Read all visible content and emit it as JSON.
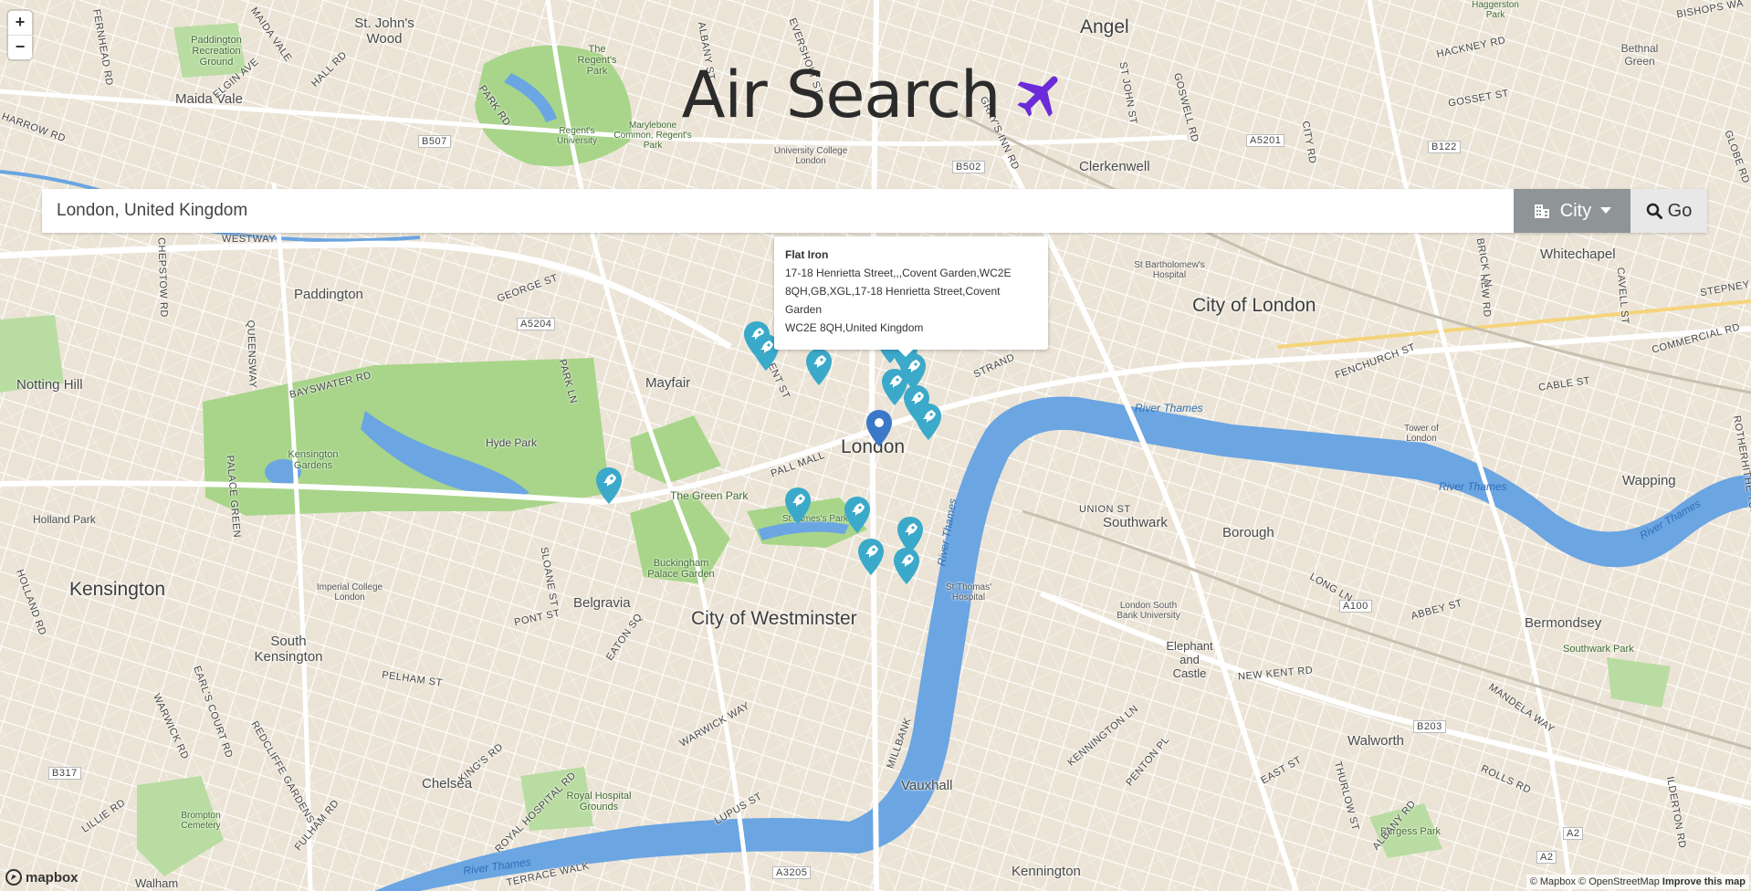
{
  "app": {
    "title": "Air Search",
    "title_icon": "airplane-icon",
    "accent_color": "#6c2bd9"
  },
  "map_controls": {
    "zoom_in": "+",
    "zoom_out": "−"
  },
  "search": {
    "value": "London, United Kingdom",
    "mode_label": "City",
    "mode_icon": "building-icon",
    "go_label": "Go",
    "go_icon": "search-icon"
  },
  "popup": {
    "title": "Flat Iron",
    "lines": [
      "17-18 Henrietta Street,,,Covent Garden,WC2E",
      "8QH,GB,XGL,17-18 Henrietta Street,Covent Garden",
      "WC2E 8QH,United Kingdom"
    ]
  },
  "map_labels": {
    "big": [
      "Angel",
      "City of London",
      "London",
      "City of Westminster",
      "Kensington"
    ],
    "mid": [
      "St. John's Wood",
      "Maida Vale",
      "Clerkenwell",
      "Paddington",
      "Notting Hill",
      "Mayfair",
      "Hyde Park",
      "Belgravia",
      "Southwark",
      "Borough",
      "Chelsea",
      "South Kensington",
      "Vauxhall",
      "Elephant and Castle",
      "Walworth",
      "Bermondsey",
      "Whitechapel",
      "Wapping",
      "Holland Park",
      "Kennington",
      "Walham"
    ],
    "parks": [
      "Paddington Recreation Ground",
      "The Regent's Park",
      "Regent's University",
      "Marylebone Common, Regent's Park",
      "Kensington Gardens",
      "The Green Park",
      "St James's Park",
      "Buckingham Palace Garden",
      "Imperial College London",
      "Royal Hospital Grounds",
      "Brompton Cemetery",
      "Burgess Park",
      "Southwark Park",
      "Tower of London",
      "University College London",
      "St Thomas' Hospital",
      "St Bartholomew's Hospital",
      "London South Bank University",
      "Haggerston Park",
      "Bethnal Green"
    ],
    "water": [
      "River Thames",
      "River Thames",
      "River Thames",
      "River Thames",
      "River Thames"
    ],
    "roads": [
      "B507",
      "B502",
      "A5201",
      "B122",
      "A5204",
      "A100",
      "A3205",
      "B317",
      "B203",
      "A2",
      "A2",
      "REGENT ST",
      "PALL MALL",
      "STRAND",
      "MILLBANK",
      "WESTWAY",
      "BAYSWATER RD",
      "PARK LN",
      "SLOANE ST",
      "PELHAM ST",
      "KING'S RD",
      "UNION ST",
      "ABBEY ST",
      "NEW KENT RD",
      "CABLE ST",
      "COMMERCIAL RD",
      "FENCHURCH ST",
      "LONG LN",
      "GEORGE ST",
      "QUEENSWAY",
      "EATON SQ",
      "PONT ST",
      "MANDELA WAY",
      "ALBANY RD",
      "ROLLS RD",
      "HACKNEY RD",
      "GOSSET ST",
      "BISHOPS WA",
      "HALL RD",
      "ELGIN AVE",
      "MAIDA VALE",
      "FERNHEAD RD",
      "HARROW RD",
      "PARK RD",
      "ALBANY ST",
      "ST JOHN ST",
      "GOSWELL RD",
      "CITY RD",
      "GRAY'S INN RD",
      "EVERSHOLT ST",
      "CHEPSTOW RD",
      "HOLLAND RD",
      "WARWICK RD",
      "FULHAM RD",
      "LILLIE RD",
      "EARL'S COURT RD",
      "REDCLIFFE GARDENS",
      "ROYAL HOSPITAL RD",
      "WARWICK WAY",
      "LUPUS ST",
      "PENTON PL",
      "KENNINGTON LN",
      "THURLOW ST",
      "EAST ST",
      "ILDERTON RD",
      "ROTHERHITHE TUNNEL",
      "NEW RD",
      "CAVELL ST",
      "STEPNEY WAY",
      "BRICK LN",
      "GLOBE RD",
      "PALACE GREEN",
      "TERRACE WALK"
    ]
  },
  "pins": {
    "count": 16,
    "color": "#3ba9c9",
    "icon": "rocket-icon",
    "center_marker_color": "#3b78c8"
  },
  "footer": {
    "logo": "mapbox",
    "attribution": "© Mapbox © OpenStreetMap",
    "improve": "Improve this map"
  }
}
